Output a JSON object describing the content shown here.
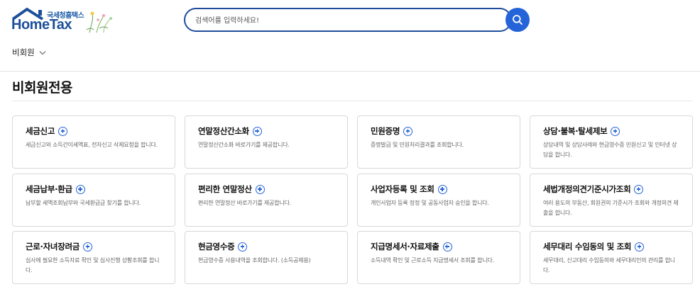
{
  "header": {
    "logo_korean": "국세청홈택스",
    "logo_english": "HomeTax",
    "search_placeholder": "검색어를 입력하세요!",
    "user_label": "비회원"
  },
  "page_title": "비회원전용",
  "colors": {
    "brand": "#1d4f9a",
    "accent": "#2563d9",
    "border": "#d8d8d8"
  },
  "cards": [
    {
      "title": "세금신고",
      "desc": "세금신고와 소득간이세액표, 전자신고 삭제요청을 합니다."
    },
    {
      "title": "연말정산간소화",
      "desc": "연말정산간소화 바로가기를 제공합니다."
    },
    {
      "title": "민원증명",
      "desc": "증명발급 및 민원처리결과를 조회합니다."
    },
    {
      "title": "상담·불복·탈세제보",
      "desc": "상담내역 및 상담사례와 현금영수증 민원신고 및 인터넷 상담을 합니다."
    },
    {
      "title": "세금납부·환급",
      "desc": "납부할 세액조회납부와 국세환급금 찾기를 합니다."
    },
    {
      "title": "편리한 연말정산",
      "desc": "편리한 연말정산 바로가기를 제공합니다."
    },
    {
      "title": "사업자등록 및 조회",
      "desc": "개인사업자 등록 정정 및 공동사업자 승인을 합니다."
    },
    {
      "title": "세법개정의견기준시가조회",
      "desc": "여러 용도의 부동산, 회원권의 기준시가 조회와 개정의견 제출을 합니다."
    },
    {
      "title": "근로·자녀장려금",
      "desc": "심사에 필요한 소득자료 확인 및 심사진행 상황조회를 합니다."
    },
    {
      "title": "현금영수증",
      "desc": "현금영수증 사용내역을 조회합니다. (소득공제용)"
    },
    {
      "title": "지급명세서·자료제출",
      "desc": "소득내역 확인 및 근로소득 지급명세서 조회를 합니다."
    },
    {
      "title": "세무대리 수임동의 및 조회",
      "desc": "세무대리, 신고대리 수임동의와 세무대리인의 관리를 합니다."
    }
  ]
}
